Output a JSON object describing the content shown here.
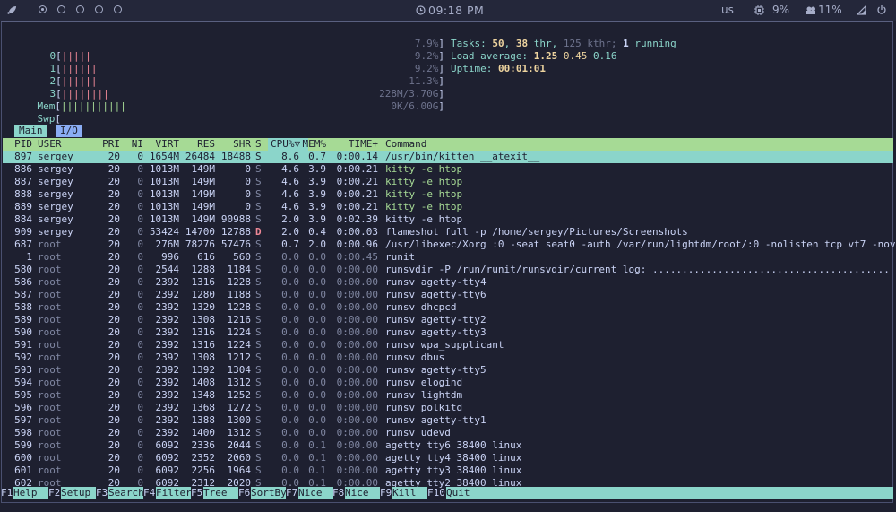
{
  "topbar": {
    "launcher_icon": "rocket-icon",
    "workspaces": [
      {
        "active": true
      },
      {
        "active": false
      },
      {
        "active": false
      },
      {
        "active": false
      },
      {
        "active": false
      }
    ],
    "clock_icon": "clock-icon",
    "clock": "09:18 PM",
    "keyboard_layout": "us",
    "cpu_icon": "cpu-icon",
    "cpu": "9%",
    "memory_icon": "memory-icon",
    "memory": "11%",
    "network_icon": "wifi-signal-icon",
    "power_icon": "power-icon"
  },
  "meters": {
    "cpu_bars": [
      {
        "label": "0",
        "bar": "|||||",
        "value": "7.9%"
      },
      {
        "label": "1",
        "bar": "||||||",
        "value": "9.2%"
      },
      {
        "label": "2",
        "bar": "||||||",
        "value": "9.2%"
      },
      {
        "label": "3",
        "bar": "||||||||",
        "value": "11.3%"
      }
    ],
    "mem": {
      "label": "Mem",
      "bar": "|||||||||||",
      "value": "228M/3.70G"
    },
    "swp": {
      "label": "Swp",
      "bar": "",
      "value": "0K/6.00G"
    }
  },
  "summary": {
    "tasks_label": "Tasks:",
    "tasks": "50",
    "threads": "38",
    "threads_label": "thr,",
    "kthreads": "125",
    "kthreads_label": "kthr;",
    "running": "1",
    "running_label": "running",
    "load_label": "Load average:",
    "load1": "1.25",
    "load5": "0.45",
    "load15": "0.16",
    "uptime_label": "Uptime:",
    "uptime": "00:01:01"
  },
  "tabs": [
    {
      "label": "Main"
    },
    {
      "label": "I/O"
    }
  ],
  "table": {
    "columns": [
      "PID",
      "USER",
      "PRI",
      "NI",
      "VIRT",
      "RES",
      "SHR",
      "S",
      "CPU%▽",
      "MEM%",
      "TIME+",
      "Command"
    ],
    "rows": [
      {
        "pid": "897",
        "user": "sergey",
        "pri": "20",
        "ni": "0",
        "virt": "1654M",
        "res": "26484",
        "shr": "18488",
        "s": "S",
        "cpu": "8.6",
        "mem": "0.7",
        "time": "0:00.14",
        "cmd": "/usr/bin/kitten __atexit__"
      },
      {
        "pid": "886",
        "user": "sergey",
        "pri": "20",
        "ni": "0",
        "virt": "1013M",
        "res": "149M",
        "shr": "0",
        "s": "S",
        "cpu": "4.6",
        "mem": "3.9",
        "time": "0:00.21",
        "cmd": "kitty -e htop"
      },
      {
        "pid": "887",
        "user": "sergey",
        "pri": "20",
        "ni": "0",
        "virt": "1013M",
        "res": "149M",
        "shr": "0",
        "s": "S",
        "cpu": "4.6",
        "mem": "3.9",
        "time": "0:00.21",
        "cmd": "kitty -e htop"
      },
      {
        "pid": "888",
        "user": "sergey",
        "pri": "20",
        "ni": "0",
        "virt": "1013M",
        "res": "149M",
        "shr": "0",
        "s": "S",
        "cpu": "4.6",
        "mem": "3.9",
        "time": "0:00.21",
        "cmd": "kitty -e htop"
      },
      {
        "pid": "889",
        "user": "sergey",
        "pri": "20",
        "ni": "0",
        "virt": "1013M",
        "res": "149M",
        "shr": "0",
        "s": "S",
        "cpu": "4.6",
        "mem": "3.9",
        "time": "0:00.21",
        "cmd": "kitty -e htop"
      },
      {
        "pid": "884",
        "user": "sergey",
        "pri": "20",
        "ni": "0",
        "virt": "1013M",
        "res": "149M",
        "shr": "90988",
        "s": "S",
        "cpu": "2.0",
        "mem": "3.9",
        "time": "0:02.39",
        "cmd": "kitty -e htop"
      },
      {
        "pid": "909",
        "user": "sergey",
        "pri": "20",
        "ni": "0",
        "virt": "53424",
        "res": "14700",
        "shr": "12788",
        "s": "D",
        "cpu": "2.0",
        "mem": "0.4",
        "time": "0:00.03",
        "cmd": "flameshot full -p /home/sergey/Pictures/Screenshots"
      },
      {
        "pid": "687",
        "user": "root",
        "pri": "20",
        "ni": "0",
        "virt": "276M",
        "res": "78276",
        "shr": "57476",
        "s": "S",
        "cpu": "0.7",
        "mem": "2.0",
        "time": "0:00.96",
        "cmd": "/usr/libexec/Xorg :0 -seat seat0 -auth /var/run/lightdm/root/:0 -nolisten tcp vt7 -nov"
      },
      {
        "pid": "1",
        "user": "root",
        "pri": "20",
        "ni": "0",
        "virt": "996",
        "res": "616",
        "shr": "560",
        "s": "S",
        "cpu": "0.0",
        "mem": "0.0",
        "time": "0:00.45",
        "cmd": "runit"
      },
      {
        "pid": "580",
        "user": "root",
        "pri": "20",
        "ni": "0",
        "virt": "2544",
        "res": "1288",
        "shr": "1184",
        "s": "S",
        "cpu": "0.0",
        "mem": "0.0",
        "time": "0:00.00",
        "cmd": "runsvdir -P /run/runit/runsvdir/current log: ........................................"
      },
      {
        "pid": "586",
        "user": "root",
        "pri": "20",
        "ni": "0",
        "virt": "2392",
        "res": "1316",
        "shr": "1228",
        "s": "S",
        "cpu": "0.0",
        "mem": "0.0",
        "time": "0:00.00",
        "cmd": "runsv agetty-tty4"
      },
      {
        "pid": "587",
        "user": "root",
        "pri": "20",
        "ni": "0",
        "virt": "2392",
        "res": "1280",
        "shr": "1188",
        "s": "S",
        "cpu": "0.0",
        "mem": "0.0",
        "time": "0:00.00",
        "cmd": "runsv agetty-tty6"
      },
      {
        "pid": "588",
        "user": "root",
        "pri": "20",
        "ni": "0",
        "virt": "2392",
        "res": "1320",
        "shr": "1228",
        "s": "S",
        "cpu": "0.0",
        "mem": "0.0",
        "time": "0:00.00",
        "cmd": "runsv dhcpcd"
      },
      {
        "pid": "589",
        "user": "root",
        "pri": "20",
        "ni": "0",
        "virt": "2392",
        "res": "1308",
        "shr": "1216",
        "s": "S",
        "cpu": "0.0",
        "mem": "0.0",
        "time": "0:00.00",
        "cmd": "runsv agetty-tty2"
      },
      {
        "pid": "590",
        "user": "root",
        "pri": "20",
        "ni": "0",
        "virt": "2392",
        "res": "1316",
        "shr": "1224",
        "s": "S",
        "cpu": "0.0",
        "mem": "0.0",
        "time": "0:00.00",
        "cmd": "runsv agetty-tty3"
      },
      {
        "pid": "591",
        "user": "root",
        "pri": "20",
        "ni": "0",
        "virt": "2392",
        "res": "1316",
        "shr": "1224",
        "s": "S",
        "cpu": "0.0",
        "mem": "0.0",
        "time": "0:00.00",
        "cmd": "runsv wpa_supplicant"
      },
      {
        "pid": "592",
        "user": "root",
        "pri": "20",
        "ni": "0",
        "virt": "2392",
        "res": "1308",
        "shr": "1212",
        "s": "S",
        "cpu": "0.0",
        "mem": "0.0",
        "time": "0:00.00",
        "cmd": "runsv dbus"
      },
      {
        "pid": "593",
        "user": "root",
        "pri": "20",
        "ni": "0",
        "virt": "2392",
        "res": "1392",
        "shr": "1304",
        "s": "S",
        "cpu": "0.0",
        "mem": "0.0",
        "time": "0:00.00",
        "cmd": "runsv agetty-tty5"
      },
      {
        "pid": "594",
        "user": "root",
        "pri": "20",
        "ni": "0",
        "virt": "2392",
        "res": "1408",
        "shr": "1312",
        "s": "S",
        "cpu": "0.0",
        "mem": "0.0",
        "time": "0:00.00",
        "cmd": "runsv elogind"
      },
      {
        "pid": "595",
        "user": "root",
        "pri": "20",
        "ni": "0",
        "virt": "2392",
        "res": "1348",
        "shr": "1252",
        "s": "S",
        "cpu": "0.0",
        "mem": "0.0",
        "time": "0:00.00",
        "cmd": "runsv lightdm"
      },
      {
        "pid": "596",
        "user": "root",
        "pri": "20",
        "ni": "0",
        "virt": "2392",
        "res": "1368",
        "shr": "1272",
        "s": "S",
        "cpu": "0.0",
        "mem": "0.0",
        "time": "0:00.00",
        "cmd": "runsv polkitd"
      },
      {
        "pid": "597",
        "user": "root",
        "pri": "20",
        "ni": "0",
        "virt": "2392",
        "res": "1388",
        "shr": "1300",
        "s": "S",
        "cpu": "0.0",
        "mem": "0.0",
        "time": "0:00.00",
        "cmd": "runsv agetty-tty1"
      },
      {
        "pid": "598",
        "user": "root",
        "pri": "20",
        "ni": "0",
        "virt": "2392",
        "res": "1400",
        "shr": "1312",
        "s": "S",
        "cpu": "0.0",
        "mem": "0.0",
        "time": "0:00.00",
        "cmd": "runsv udevd"
      },
      {
        "pid": "599",
        "user": "root",
        "pri": "20",
        "ni": "0",
        "virt": "6092",
        "res": "2336",
        "shr": "2044",
        "s": "S",
        "cpu": "0.0",
        "mem": "0.1",
        "time": "0:00.00",
        "cmd": "agetty tty6 38400 linux"
      },
      {
        "pid": "600",
        "user": "root",
        "pri": "20",
        "ni": "0",
        "virt": "6092",
        "res": "2352",
        "shr": "2060",
        "s": "S",
        "cpu": "0.0",
        "mem": "0.1",
        "time": "0:00.00",
        "cmd": "agetty tty4 38400 linux"
      },
      {
        "pid": "601",
        "user": "root",
        "pri": "20",
        "ni": "0",
        "virt": "6092",
        "res": "2256",
        "shr": "1964",
        "s": "S",
        "cpu": "0.0",
        "mem": "0.1",
        "time": "0:00.00",
        "cmd": "agetty tty3 38400 linux"
      },
      {
        "pid": "602",
        "user": "root",
        "pri": "20",
        "ni": "0",
        "virt": "6092",
        "res": "2312",
        "shr": "2020",
        "s": "S",
        "cpu": "0.0",
        "mem": "0.1",
        "time": "0:00.00",
        "cmd": "agetty tty2 38400 linux"
      }
    ]
  },
  "function_keys": [
    {
      "key": "F1",
      "label": "Help"
    },
    {
      "key": "F2",
      "label": "Setup"
    },
    {
      "key": "F3",
      "label": "Search"
    },
    {
      "key": "F4",
      "label": "Filter"
    },
    {
      "key": "F5",
      "label": "Tree"
    },
    {
      "key": "F6",
      "label": "SortBy"
    },
    {
      "key": "F7",
      "label": "Nice -"
    },
    {
      "key": "F8",
      "label": "Nice +"
    },
    {
      "key": "F9",
      "label": "Kill"
    },
    {
      "key": "F10",
      "label": "Quit"
    }
  ],
  "colors": {
    "background": "#1e2030",
    "header_bg": "#a6da95",
    "selection_bg": "#8bd5ca",
    "user_process": "#cad3f5",
    "root_process": "#8087a2",
    "thread_cmd": "#a6da95",
    "state_d": "#ed8796"
  }
}
